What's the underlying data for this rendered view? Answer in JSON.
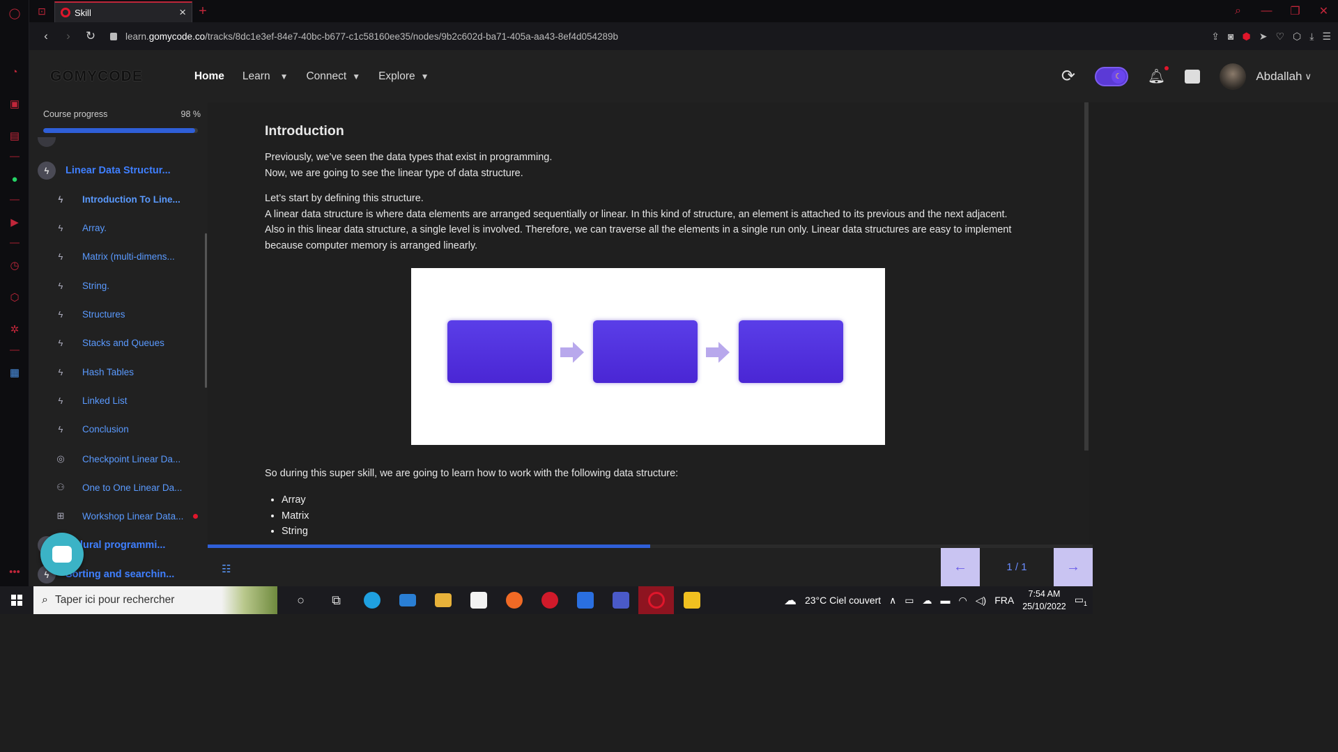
{
  "browser": {
    "tab_title": "Skill",
    "url_prefix": "learn.",
    "url_host": "gomycode.co",
    "url_path": "/tracks/8dc1e3ef-84e7-40bc-b677-c1c58160ee35/nodes/9b2c602d-ba71-405a-aa43-8ef4d054289b"
  },
  "header": {
    "logo": "GOMYCODE",
    "nav": [
      {
        "label": "Home"
      },
      {
        "label": "Learn"
      },
      {
        "label": "Connect"
      },
      {
        "label": "Explore"
      }
    ],
    "username": "Abdallah"
  },
  "sidebar": {
    "progress_label": "Course progress",
    "progress_pct_text": "98 %",
    "progress_value": 0.98,
    "section_title": "Linear Data Structur...",
    "lessons": [
      {
        "label": "Introduction To Line...",
        "icon": "bolt-icon"
      },
      {
        "label": "Array.",
        "icon": "bolt-icon"
      },
      {
        "label": "Matrix (multi-dimens...",
        "icon": "bolt-icon"
      },
      {
        "label": "String.",
        "icon": "bolt-icon"
      },
      {
        "label": "Structures",
        "icon": "bolt-icon"
      },
      {
        "label": "Stacks and Queues",
        "icon": "bolt-icon"
      },
      {
        "label": "Hash Tables",
        "icon": "bolt-icon"
      },
      {
        "label": "Linked List",
        "icon": "bolt-icon"
      },
      {
        "label": "Conclusion",
        "icon": "bolt-icon"
      },
      {
        "label": "Checkpoint Linear Da...",
        "icon": "target-icon"
      },
      {
        "label": "One to One Linear Da...",
        "icon": "people-icon"
      },
      {
        "label": "Workshop Linear Data...",
        "icon": "workshop-icon"
      }
    ],
    "next_section": "Procedural programmi...",
    "next_section_visible": "cedural programmi...",
    "last_section": "Sorting and searchin..."
  },
  "content": {
    "title": "Introduction",
    "p1_line1": "Previously, we’ve seen the data types that exist in programming.",
    "p1_line2": "Now, we are going to see the linear type of data structure.",
    "p2_line1": "Let’s start by defining this structure.",
    "p2_line2": "A linear data structure is where data elements are arranged sequentially or linear. In this kind of structure, an element is attached to its previous and the next adjacent.",
    "p2_line3": "Also in this linear data structure, a single level is involved. Therefore, we can traverse all the elements in a single run only. Linear data structures are easy to implement",
    "p2_line4": "because computer memory is arranged linearly.",
    "p3": "So during this super skill, we are going to learn how to work with the following data structure:",
    "list": [
      "Array",
      "Matrix",
      "String"
    ]
  },
  "pager": {
    "label": "1 / 1",
    "prev": "←",
    "next": "→",
    "progress_value": 0.5
  },
  "taskbar": {
    "search_placeholder": "Taper ici pour rechercher",
    "weather": "23°C  Ciel couvert",
    "lang": "FRA",
    "time": "7:54 AM",
    "date": "25/10/2022",
    "notif_count": "1"
  },
  "colors": {
    "accent_blue": "#2f5fd8",
    "link_blue": "#5a9aff",
    "opera_red": "#e0162b",
    "diagram_purple": "#4a26d4"
  }
}
